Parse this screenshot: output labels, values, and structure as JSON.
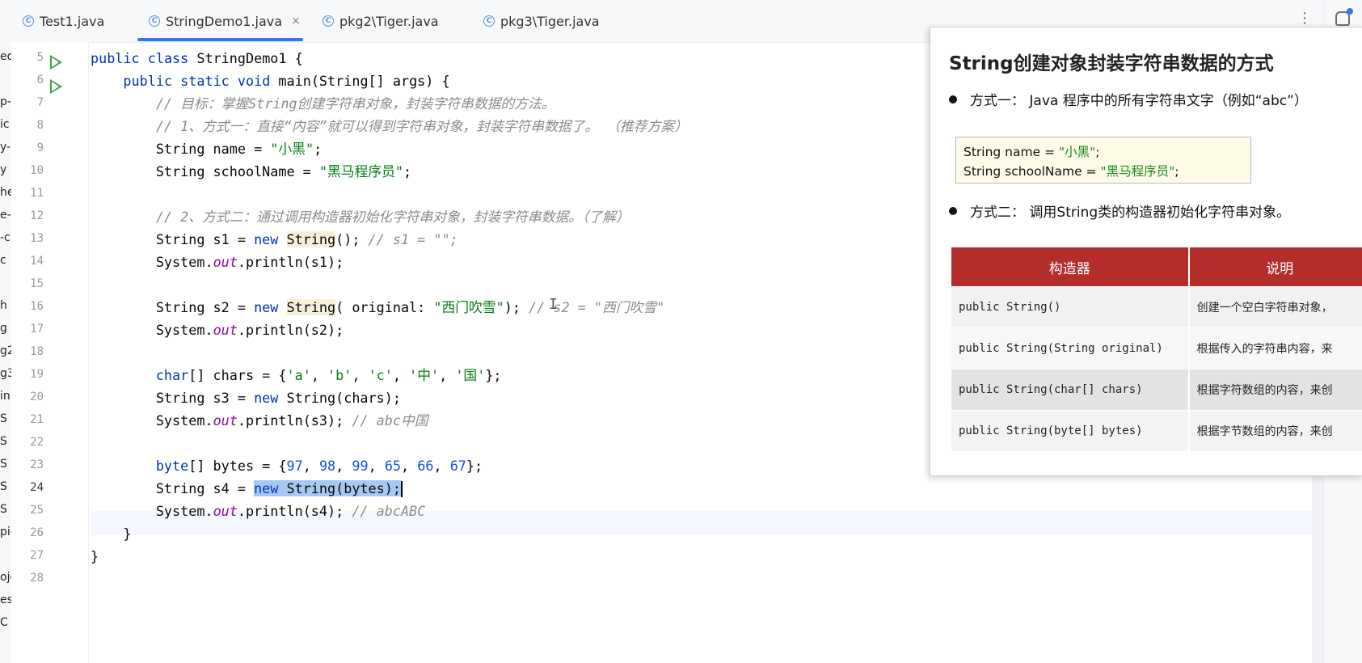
{
  "editor": {
    "tabs": [
      {
        "label": "Test1.java",
        "active": false
      },
      {
        "label": "StringDemo1.java",
        "active": true
      },
      {
        "label": "pkg2\\Tiger.java",
        "active": false
      },
      {
        "label": "pkg3\\Tiger.java",
        "active": false
      }
    ],
    "tab_close_glyph": "×",
    "more_glyph": "⋮",
    "project_fragments": [
      "ed",
      "p-",
      "ic",
      "y-",
      "y",
      "he",
      "e-",
      "-c",
      "c",
      "h",
      "g",
      "g2",
      "g3",
      "in",
      "S",
      "S",
      "S",
      "S",
      "S",
      "pi-",
      "oje",
      "es",
      "C"
    ],
    "caret_line": "24",
    "code_lines": [
      {
        "n": "5",
        "t": "public class StringDemo1 {"
      },
      {
        "n": "6",
        "t": "    public static void main(String[] args) {"
      },
      {
        "n": "7",
        "t": "        // 目标：掌握String创建字符串对象，封装字符串数据的方法。"
      },
      {
        "n": "8",
        "t": "        // 1、方式一：直接“内容”就可以得到字符串对象，封装字符串数据了。 （推荐方案）"
      },
      {
        "n": "9",
        "t": "        String name = \"小黑\";"
      },
      {
        "n": "10",
        "t": "        String schoolName = \"黑马程序员\";"
      },
      {
        "n": "11",
        "t": ""
      },
      {
        "n": "12",
        "t": "        // 2、方式二：通过调用构造器初始化字符串对象，封装字符串数据。（了解）"
      },
      {
        "n": "13",
        "t": "        String s1 = new String(); // s1 = \"\";"
      },
      {
        "n": "14",
        "t": "        System.out.println(s1);"
      },
      {
        "n": "15",
        "t": ""
      },
      {
        "n": "16",
        "t": "        String s2 = new String( original: \"西门吹雪\"); // s2 = \"西门吹雪\""
      },
      {
        "n": "17",
        "t": "        System.out.println(s2);"
      },
      {
        "n": "18",
        "t": ""
      },
      {
        "n": "19",
        "t": "        char[] chars = {'a', 'b', 'c', '中', '国'};"
      },
      {
        "n": "20",
        "t": "        String s3 = new String(chars);"
      },
      {
        "n": "21",
        "t": "        System.out.println(s3); // abc中国"
      },
      {
        "n": "22",
        "t": ""
      },
      {
        "n": "23",
        "t": "        byte[] bytes = {97, 98, 99, 65, 66, 67};"
      },
      {
        "n": "24",
        "t": "        String s4 = new String(bytes);"
      },
      {
        "n": "25",
        "t": "        System.out.println(s4); // abcABC"
      },
      {
        "n": "26",
        "t": "    }"
      },
      {
        "n": "27",
        "t": "}"
      },
      {
        "n": "28",
        "t": ""
      }
    ]
  },
  "slide": {
    "title": "String创建对象封装字符串数据的方式",
    "bullet1": "方式一：  Java 程序中的所有字符串文字（例如“abc”）",
    "code_line1_prefix": "String name = ",
    "code_line1_value": "\"小黑\"",
    "code_line1_suffix": ";",
    "code_line2_prefix": "String schoolName = ",
    "code_line2_value": "\"黑马程序员\"",
    "code_line2_suffix": ";",
    "bullet2": "方式二：  调用String类的构造器初始化字符串对象。",
    "table_headers": [
      "构造器",
      "说明"
    ],
    "table_rows": [
      {
        "ctor": "public String()",
        "desc": "创建一个空白字符串对象，"
      },
      {
        "ctor": "public String(String original)",
        "desc": "根据传入的字符串内容，来"
      },
      {
        "ctor": "public String(char[] chars)",
        "desc": "根据字符数组的内容，来创"
      },
      {
        "ctor": "public String(byte[] bytes)",
        "desc": "根据字节数组的内容，来创"
      }
    ]
  },
  "colors": {
    "keyword": "#0033b3",
    "string": "#067d17",
    "number": "#1750eb",
    "comment": "#8c8c8c",
    "field": "#871094",
    "selection": "#a6c8f4",
    "table_header": "#b42d2d",
    "active_tab": "#3574f0",
    "run_icon": "#3fa34d"
  },
  "icons": {
    "tab_file": "c-class-icon",
    "run": "run-gutter-icon",
    "intention": "lightbulb-icon",
    "notifications": "bell-icon"
  }
}
